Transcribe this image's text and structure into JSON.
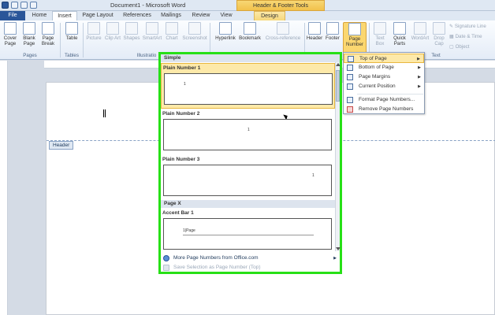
{
  "window": {
    "title": "Document1 - Microsoft Word",
    "context_tools_label": "Header & Footer Tools"
  },
  "tabs": {
    "file": "File",
    "home": "Home",
    "insert": "Insert",
    "page_layout": "Page Layout",
    "references": "References",
    "mailings": "Mailings",
    "review": "Review",
    "view": "View",
    "design": "Design"
  },
  "ribbon": {
    "cover_page": "Cover Page",
    "blank_page": "Blank Page",
    "page_break": "Page Break",
    "table": "Table",
    "picture": "Picture",
    "clip_art": "Clip Art",
    "shapes": "Shapes",
    "smartart": "SmartArt",
    "chart": "Chart",
    "screenshot": "Screenshot",
    "hyperlink": "Hyperlink",
    "bookmark": "Bookmark",
    "cross_reference": "Cross-reference",
    "header": "Header",
    "footer": "Footer",
    "page_number": "Page Number",
    "text_box": "Text Box",
    "quick_parts": "Quick Parts",
    "wordart": "WordArt",
    "drop_cap": "Drop Cap",
    "signature_line": "Signature Line",
    "date_time": "Date & Time",
    "object": "Object",
    "groups": {
      "pages": "Pages",
      "tables": "Tables",
      "illustrations": "Illustratio",
      "text": "Text"
    }
  },
  "document": {
    "header_tag": "Header",
    "cursor_char": "1"
  },
  "gallery": {
    "section_simple": "Simple",
    "items": [
      {
        "label": "Plain Number 1",
        "sample": "1"
      },
      {
        "label": "Plain Number 2",
        "sample": "1"
      },
      {
        "label": "Plain Number 3",
        "sample": "1"
      }
    ],
    "section_pagex": "Page X",
    "accent_bar": {
      "label": "Accent Bar 1",
      "sample": "1|Page"
    },
    "more": "More Page Numbers from Office.com",
    "save_selection": "Save Selection as Page Number (Top)"
  },
  "menu": {
    "top_of_page": "Top of Page",
    "bottom_of_page": "Bottom of Page",
    "page_margins": "Page Margins",
    "current_position": "Current Position",
    "format_page_numbers": "Format Page Numbers...",
    "remove_page_numbers": "Remove Page Numbers"
  },
  "colors": {
    "highlight_border": "#27e016",
    "selected_fill": "#fde9a9",
    "file_tab": "#2a5699"
  }
}
